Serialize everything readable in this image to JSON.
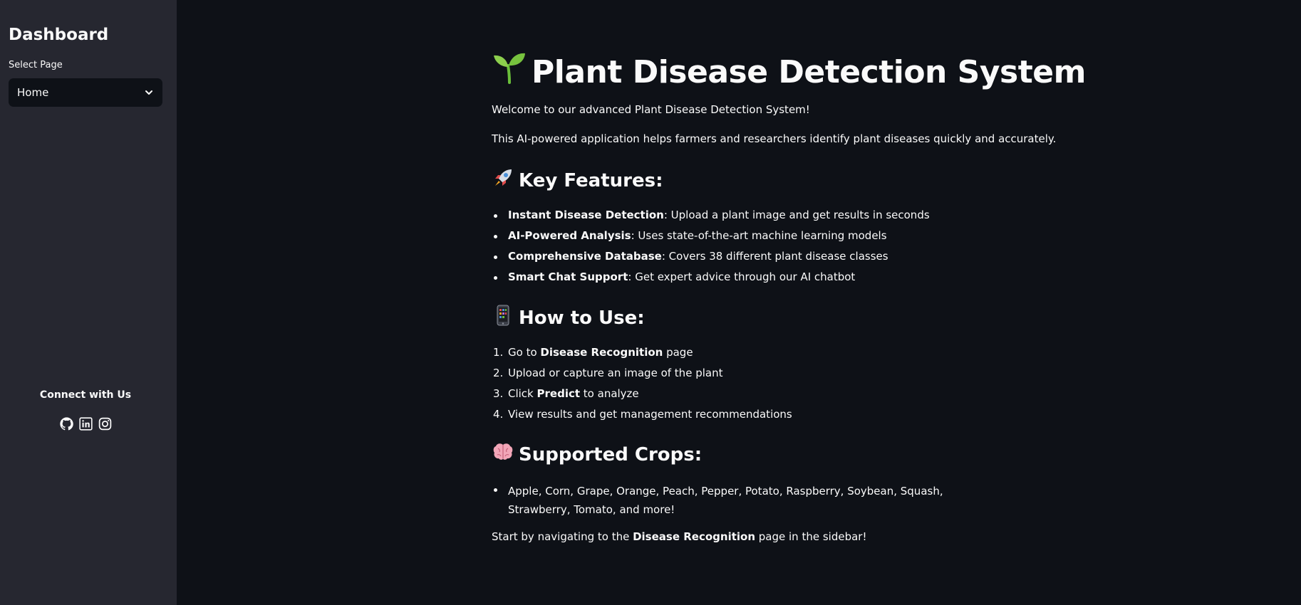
{
  "sidebar": {
    "title": "Dashboard",
    "select_label": "Select Page",
    "select_value": "Home",
    "connect_title": "Connect with Us",
    "social_icons": [
      "github-icon",
      "linkedin-icon",
      "instagram-icon"
    ]
  },
  "main": {
    "title": "Plant Disease Detection System",
    "title_emoji": "seedling",
    "welcome": "Welcome to our advanced Plant Disease Detection System!",
    "intro": "This AI-powered application helps farmers and researchers identify plant diseases quickly and accurately.",
    "features": {
      "heading": "Key Features:",
      "emoji": "rocket",
      "items": [
        {
          "bold": "Instant Disease Detection",
          "text": ": Upload a plant image and get results in seconds"
        },
        {
          "bold": "AI-Powered Analysis",
          "text": ": Uses state-of-the-art machine learning models"
        },
        {
          "bold": "Comprehensive Database",
          "text": ": Covers 38 different plant disease classes"
        },
        {
          "bold": "Smart Chat Support",
          "text": ": Get expert advice through our AI chatbot"
        }
      ]
    },
    "how_to": {
      "heading": "How to Use:",
      "emoji": "mobile-phone",
      "items": [
        {
          "num": "1.",
          "pre": "Go to ",
          "bold": "Disease Recognition",
          "post": " page"
        },
        {
          "num": "2.",
          "pre": "Upload or capture an image of the plant",
          "bold": "",
          "post": ""
        },
        {
          "num": "3.",
          "pre": "Click ",
          "bold": "Predict",
          "post": " to analyze"
        },
        {
          "num": "4.",
          "pre": "View results and get management recommendations",
          "bold": "",
          "post": ""
        }
      ]
    },
    "crops": {
      "heading": "Supported Crops:",
      "emoji": "brain",
      "items": [
        "Apple, Corn, Grape, Orange, Peach, Pepper, Potato, Raspberry, Soybean, Squash, Strawberry, Tomato, and more!"
      ]
    },
    "footer": {
      "pre": "Start by navigating to the ",
      "bold": "Disease Recognition",
      "post": " page in the sidebar!"
    }
  }
}
